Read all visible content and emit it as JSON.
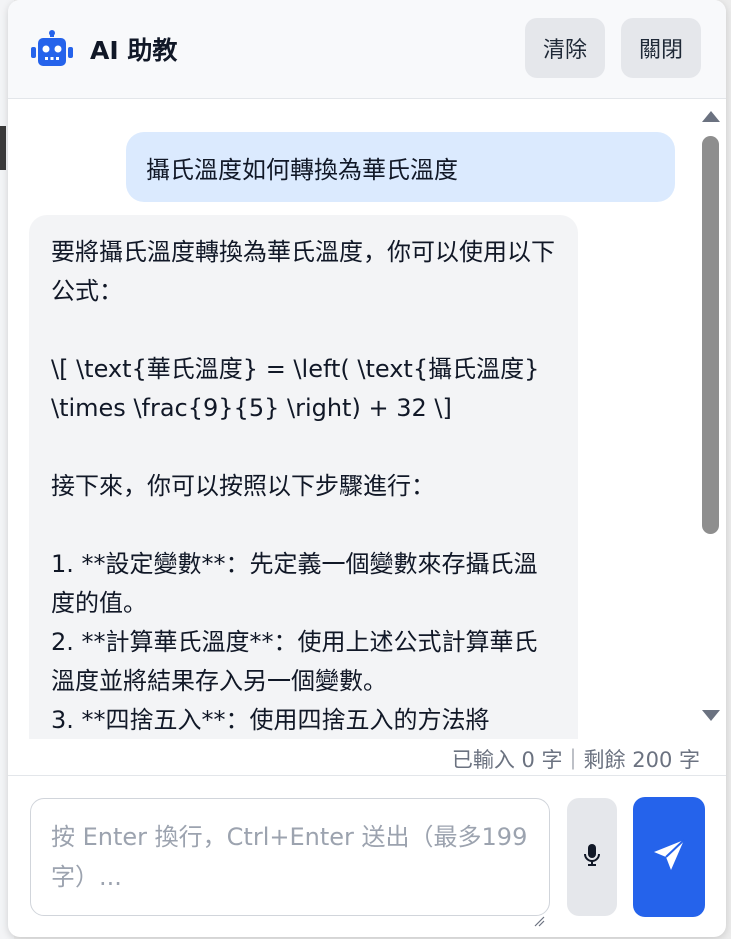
{
  "header": {
    "title": "AI 助教",
    "clear_label": "清除",
    "close_label": "關閉",
    "icon": "robot-icon"
  },
  "messages": [
    {
      "role": "user",
      "text": "攝氏溫度如何轉換為華氏溫度"
    },
    {
      "role": "assistant",
      "text": "要將攝氏溫度轉換為華氏溫度，你可以使用以下公式：\n\n\\[ \\text{華氏溫度} = \\left( \\text{攝氏溫度} \\times \\frac{9}{5} \\right) + 32 \\]\n\n接下來，你可以按照以下步驟進行：\n\n1. **設定變數**：先定義一個變數來存攝氏溫度的值。\n2. **計算華氏溫度**：使用上述公式計算華氏溫度並將結果存入另一個變數。\n3. **四捨五入**：使用四捨五入的方法將"
    }
  ],
  "counter": "已輸入 0 字｜剩餘 200 字",
  "input": {
    "placeholder": "按 Enter 換行，Ctrl+Enter 送出（最多199字）...",
    "value": ""
  },
  "icons": {
    "mic": "microphone-icon",
    "send": "send-icon"
  },
  "colors": {
    "user_bubble": "#dbeafe",
    "assistant_bubble": "#f3f4f6",
    "send_button": "#2563eb",
    "robot_icon": "#2563eb"
  }
}
